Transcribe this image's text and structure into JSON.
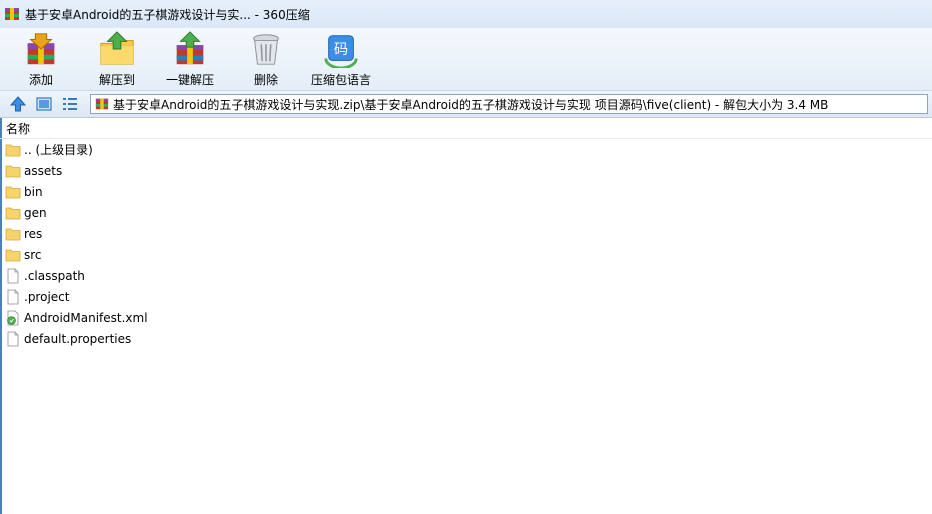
{
  "window": {
    "title": "基于安卓Android的五子棋游戏设计与实... - 360压缩"
  },
  "toolbar": {
    "items": [
      {
        "label": "添加",
        "icon": "add-archive-icon"
      },
      {
        "label": "解压到",
        "icon": "extract-to-icon"
      },
      {
        "label": "一键解压",
        "icon": "one-click-extract-icon"
      },
      {
        "label": "删除",
        "icon": "delete-icon"
      },
      {
        "label": "压缩包语言",
        "icon": "archive-language-icon"
      }
    ],
    "language_icon_glyph": "码"
  },
  "address": {
    "path": "基于安卓Android的五子棋游戏设计与实现.zip\\基于安卓Android的五子棋游戏设计与实现 项目源码\\five(client) - 解包大小为 3.4 MB"
  },
  "list": {
    "header": "名称",
    "items": [
      {
        "name": ".. (上级目录)",
        "type": "folder"
      },
      {
        "name": "assets",
        "type": "folder"
      },
      {
        "name": "bin",
        "type": "folder"
      },
      {
        "name": "gen",
        "type": "folder"
      },
      {
        "name": "res",
        "type": "folder"
      },
      {
        "name": "src",
        "type": "folder"
      },
      {
        "name": ".classpath",
        "type": "file"
      },
      {
        "name": ".project",
        "type": "file"
      },
      {
        "name": "AndroidManifest.xml",
        "type": "xml"
      },
      {
        "name": "default.properties",
        "type": "file"
      }
    ]
  },
  "colors": {
    "accent": "#4a7fc0",
    "folder": "#f7d46a"
  }
}
